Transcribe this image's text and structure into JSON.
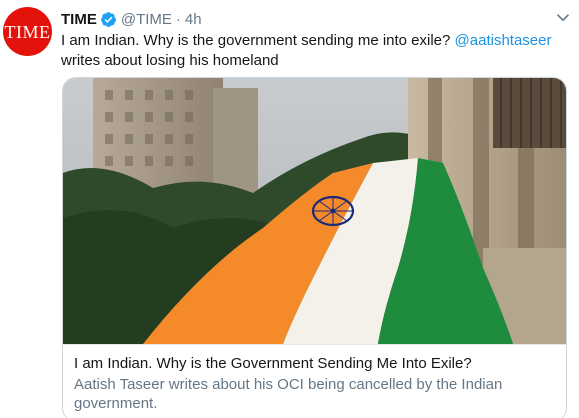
{
  "tweet": {
    "avatar_text": "TIME",
    "display_name": "TIME",
    "handle": "@TIME",
    "separator": "·",
    "timestamp": "4h",
    "text_before": "I am Indian. Why is the government sending me into exile?",
    "mention": "@aatishtaseer",
    "text_after": "writes about losing his homeland"
  },
  "card": {
    "title": "I am Indian. Why is the Government Sending Me Into Exile?",
    "description": "Aatish Taseer writes about his OCI being cancelled by the Indian government."
  },
  "colors": {
    "brand_red": "#e3120b",
    "link_blue": "#1b95e0",
    "secondary_text": "#657786",
    "flag_saffron": "#f58a2b",
    "flag_green": "#1f8b3c",
    "chakra_navy": "#1a2a7a"
  },
  "icons": [
    "verified-badge-icon",
    "chevron-down-icon"
  ]
}
